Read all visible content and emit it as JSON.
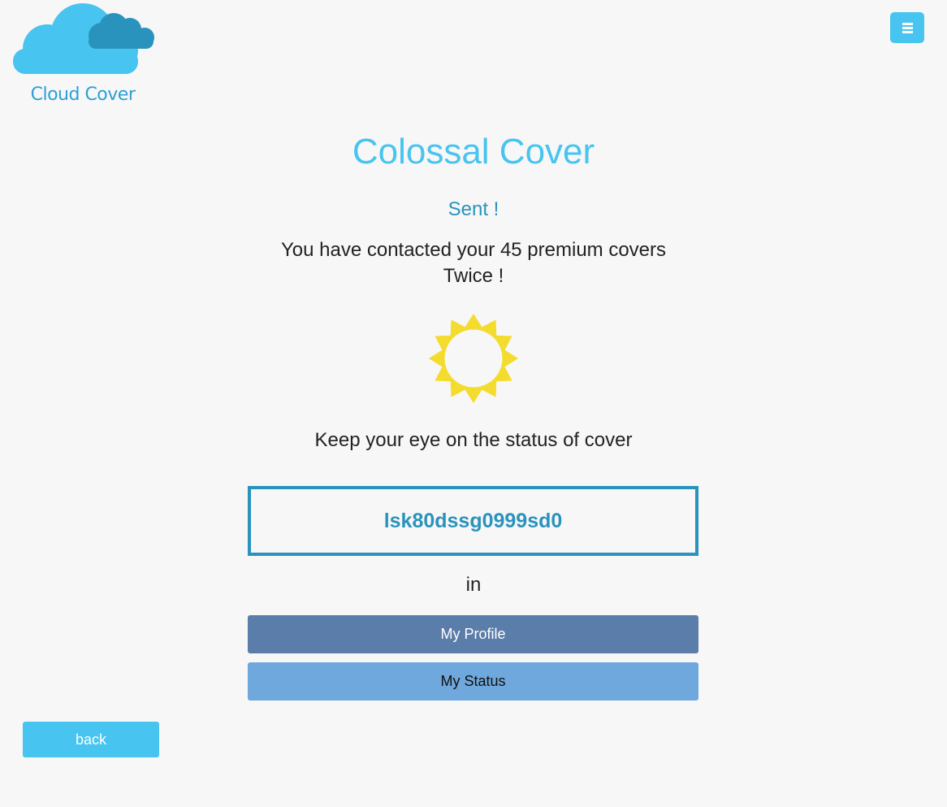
{
  "header": {
    "logo_text": "Cloud Cover",
    "menu_icon": "hamburger-menu-icon"
  },
  "main": {
    "title": "Colossal Cover",
    "status": "Sent !",
    "message_line1": "You have contacted your 45 premium covers",
    "message_line2": "Twice !",
    "weather_icon": "sun-icon",
    "keep_text": "Keep your eye on the status of cover",
    "cover_code": "lsk80dssg0999sd0",
    "in_text": "in",
    "profile_button": "My Profile",
    "status_button": "My Status"
  },
  "footer": {
    "back_button": "back"
  },
  "colors": {
    "accent": "#47c4f0",
    "dark_accent": "#2a93bd",
    "profile_button": "#5a7daa",
    "status_button": "#6fa8dc",
    "sun": "#f4dc2e",
    "background": "#f7f7f7"
  }
}
